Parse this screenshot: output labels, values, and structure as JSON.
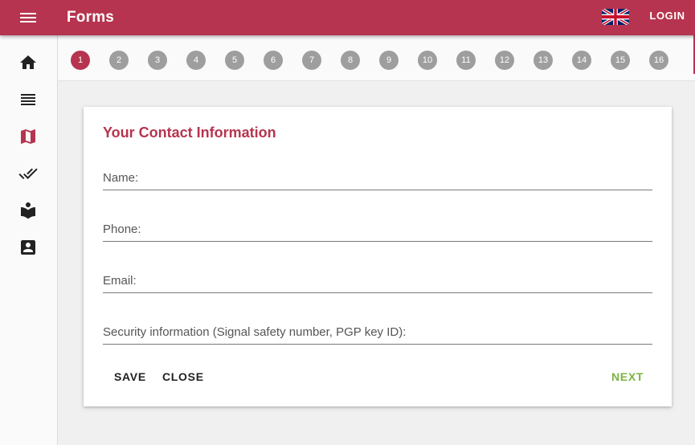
{
  "app": {
    "title": "Forms"
  },
  "header": {
    "login_label": "LOGIN",
    "language_icon": "uk-flag-icon"
  },
  "sidebar": {
    "items": [
      {
        "icon": "home-icon"
      },
      {
        "icon": "list-icon"
      },
      {
        "icon": "map-icon"
      },
      {
        "icon": "double-check-icon"
      },
      {
        "icon": "reader-icon"
      },
      {
        "icon": "contact-card-icon"
      }
    ]
  },
  "stepper": {
    "steps": [
      "1",
      "2",
      "3",
      "4",
      "5",
      "6",
      "7",
      "8",
      "9",
      "10",
      "11",
      "12",
      "13",
      "14",
      "15",
      "16"
    ],
    "active": "1"
  },
  "form": {
    "title": "Your Contact Information",
    "fields": [
      {
        "label": "Name:",
        "value": ""
      },
      {
        "label": "Phone:",
        "value": ""
      },
      {
        "label": "Email:",
        "value": ""
      },
      {
        "label": "Security information (Signal safety number, PGP key ID):",
        "value": ""
      }
    ],
    "save_label": "SAVE",
    "close_label": "CLOSE",
    "next_label": "NEXT"
  },
  "colors": {
    "primary": "#b6344f",
    "next": "#7cb342",
    "step_inactive": "#9e9e9e"
  }
}
